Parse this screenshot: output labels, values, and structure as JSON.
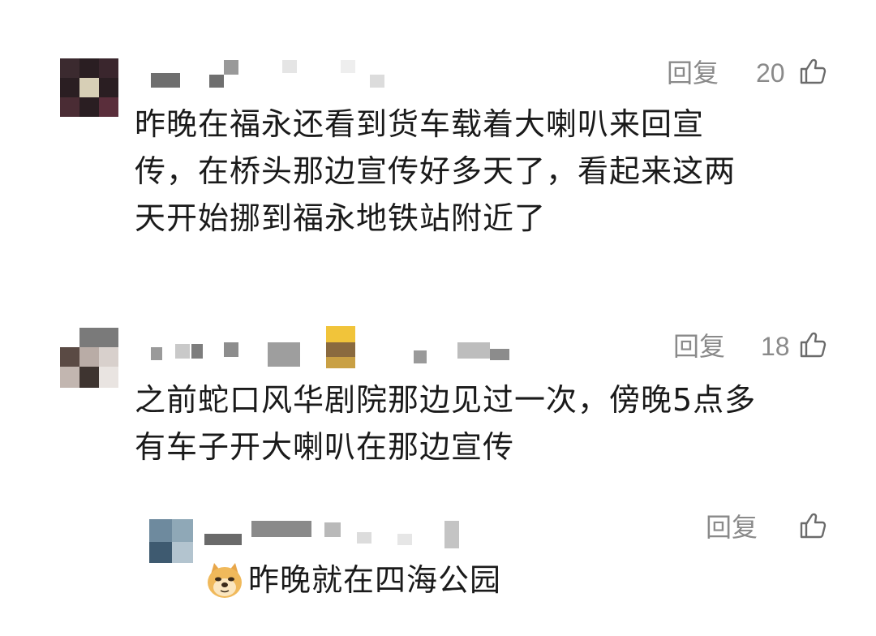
{
  "comments": [
    {
      "text": "昨晚在福永还看到货车载着大喇叭来回宣传，在桥头那边宣传好多天了，看起来这两天开始挪到福永地铁站附近了",
      "lines": [
        "昨晚在福永还看到货车载着大喇叭来回宣",
        "传，在桥头那边宣传好多天了，看起来这两",
        "天开始挪到福永地铁站附近了"
      ],
      "reply_label": "回复",
      "like_count": "20",
      "like_icon": "thumbs-up-icon"
    },
    {
      "text": "之前蛇口风华剧院那边见过一次，傍晚5点多有车子开大喇叭在那边宣传",
      "lines": [
        "之前蛇口风华剧院那边见过一次，傍晚5点多",
        "有车子开大喇叭在那边宣传"
      ],
      "reply_label": "回复",
      "like_count": "18",
      "like_icon": "thumbs-up-icon"
    }
  ],
  "reply": {
    "emoji": "doge-emoji",
    "text": "昨晚就在四海公园",
    "reply_label": "回复",
    "like_icon": "thumbs-up-icon"
  },
  "colors": {
    "text": "#1a1a1a",
    "meta": "#8a8a8a",
    "background": "#ffffff"
  }
}
